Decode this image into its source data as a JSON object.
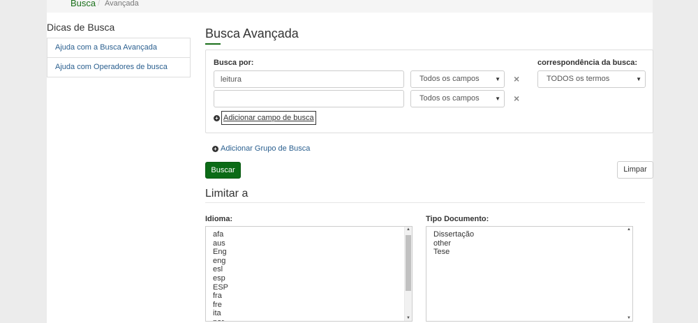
{
  "breadcrumb": {
    "home": "Busca",
    "separator": "/",
    "current": "Avançada"
  },
  "sidebar": {
    "title": "Dicas de Busca",
    "items": [
      {
        "label": "Ajuda com a Busca Avançada"
      },
      {
        "label": "Ajuda com Operadores de busca"
      }
    ]
  },
  "main": {
    "title": "Busca Avançada",
    "search_by_label": "Busca por:",
    "rows": [
      {
        "value": "leitura",
        "field": "Todos os campos"
      },
      {
        "value": "",
        "field": "Todos os campos"
      }
    ],
    "match_label": "correspondência da busca:",
    "match_value": "TODOS os termos",
    "add_field": "Adicionar campo de busca",
    "add_group": "Adicionar Grupo de Busca",
    "search_button": "Buscar",
    "clear_button": "Limpar"
  },
  "limit": {
    "title": "Limitar a",
    "language_label": "Idioma:",
    "languages": [
      "afa",
      "aus",
      "Eng",
      "eng",
      "esl",
      "esp",
      "ESP",
      "fra",
      "fre",
      "ita",
      "por"
    ],
    "doctype_label": "Tipo Documento:",
    "doctypes": [
      "Dissertação",
      "other",
      "Tese"
    ]
  },
  "colors": {
    "accent": "#0b6b16",
    "link": "#2a5f8f"
  },
  "icons": {
    "remove": "close-icon",
    "add": "plus-circle-icon",
    "caret": "caret-down-icon"
  }
}
